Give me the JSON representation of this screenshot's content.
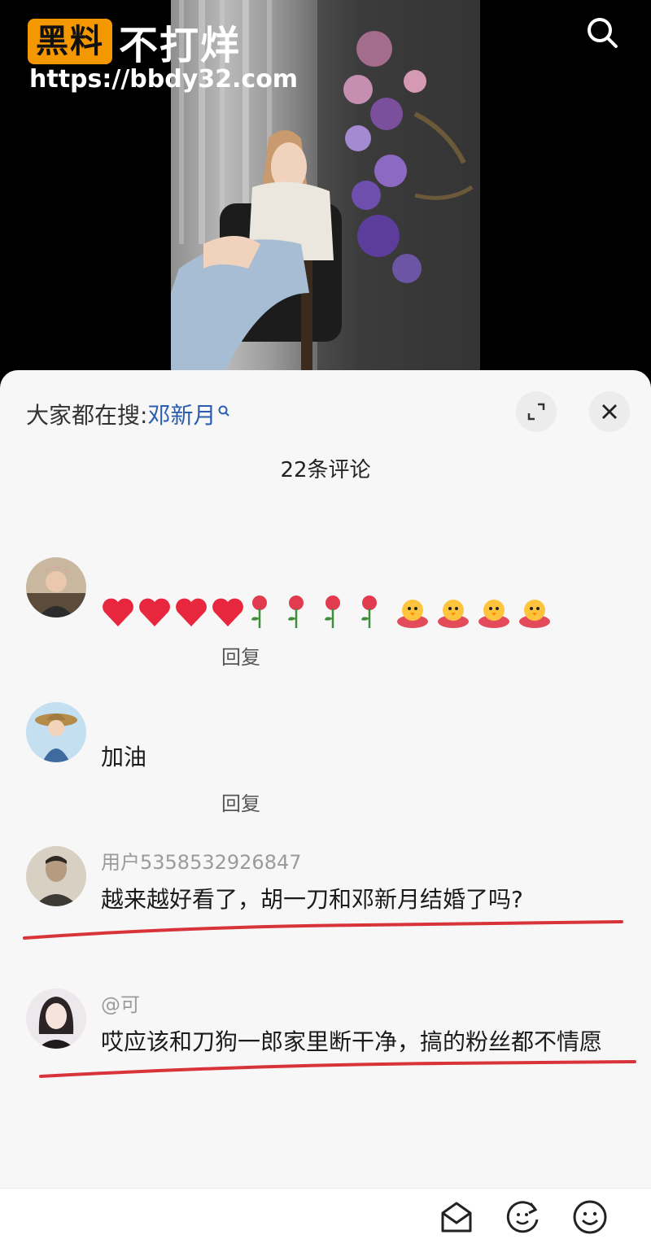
{
  "watermark": {
    "badge": "黑料",
    "text": "不打烊",
    "url": "https://bbdy32.com"
  },
  "top_icons": {
    "search": "search-icon"
  },
  "panel": {
    "hot_search_label": "大家都在搜:",
    "hot_search_term": "邓新月",
    "comment_count": "22条评论",
    "icons": {
      "expand": "expand-icon",
      "close": "close-icon"
    }
  },
  "comments": [
    {
      "username": "",
      "emojis": [
        "heart",
        "heart",
        "heart",
        "heart",
        "rose",
        "rose",
        "rose",
        "rose",
        "chick",
        "chick",
        "chick",
        "chick"
      ],
      "reply": "回复"
    },
    {
      "username": "",
      "text": "加油",
      "meta": "",
      "reply": "回复"
    },
    {
      "username": "用户5358532926847",
      "text": "越来越好看了，胡一刀和邓新月结婚了吗?"
    },
    {
      "username": "@可",
      "text": "哎应该和刀狗一郎家里断干净，搞的粉丝都不情愿"
    }
  ],
  "bottom_bar": {
    "input_placeholder": "",
    "icons": [
      "gift-icon",
      "refresh-emoji-icon",
      "smile-icon"
    ]
  },
  "colors": {
    "watermark_badge": "#f39800",
    "link_blue": "#2a5db0",
    "underline_red": "#d9333a",
    "sheet_bg": "#f7f7f7"
  }
}
